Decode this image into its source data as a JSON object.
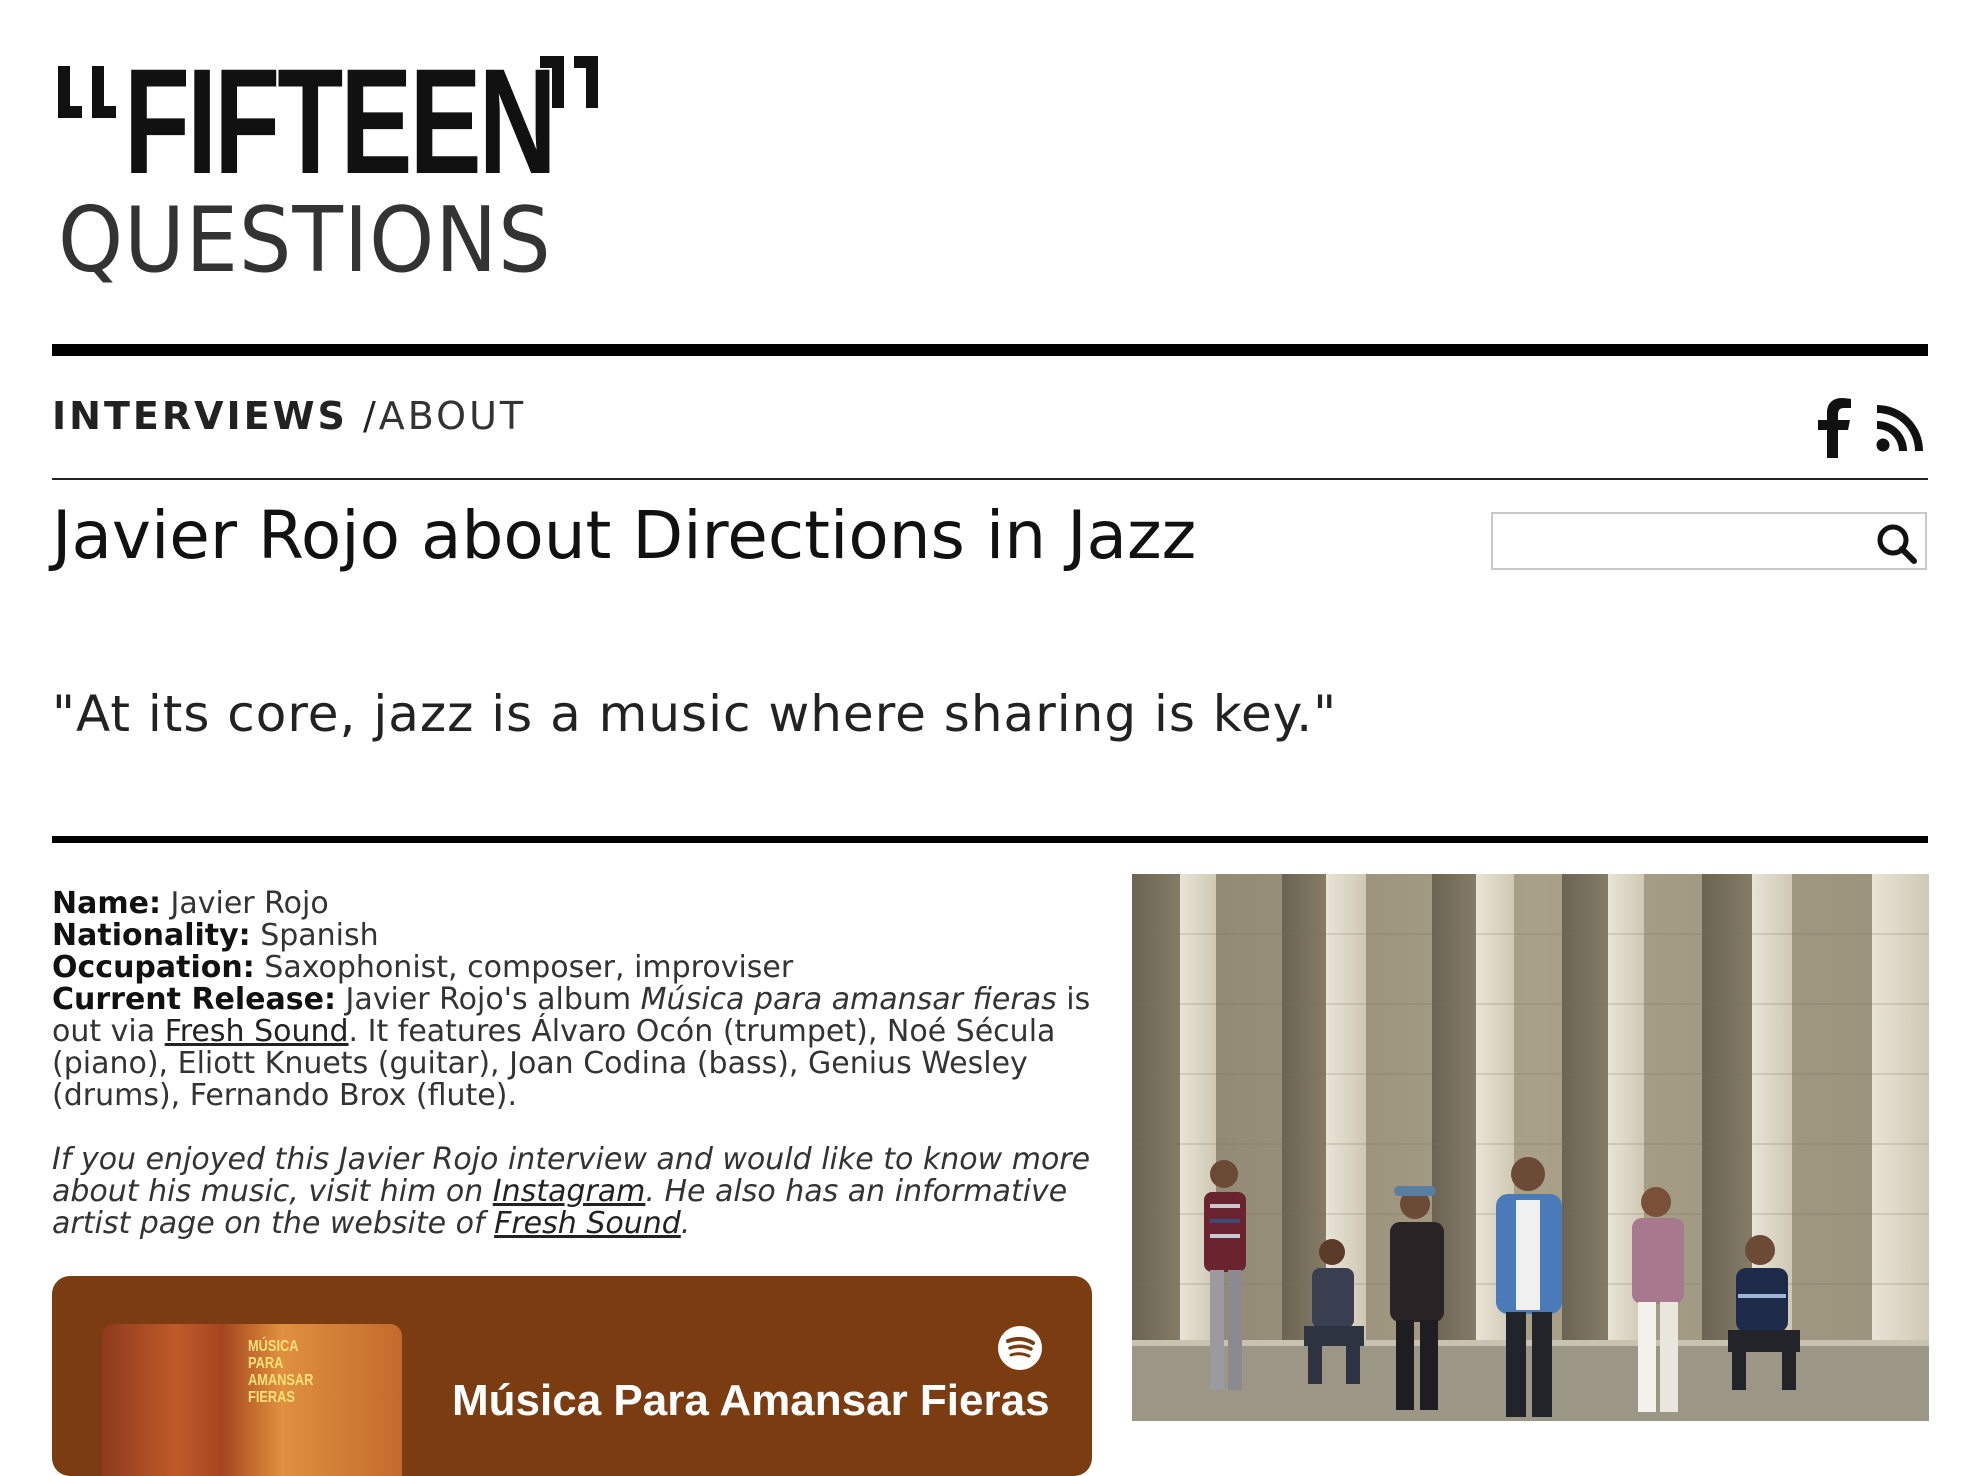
{
  "site": {
    "logo_top": "FIFTEEN",
    "logo_bottom": "QUESTIONS"
  },
  "nav": {
    "interviews": "INTERVIEWS",
    "separator": " /",
    "about": "ABOUT"
  },
  "social": {
    "icons": [
      "facebook-icon",
      "rss-icon"
    ]
  },
  "search": {
    "value": "",
    "placeholder": ""
  },
  "article": {
    "title": "Javier Rojo about Directions in Jazz",
    "quote": "\"At its core, jazz is a music where sharing is key.\""
  },
  "info": {
    "name_label": "Name:",
    "name": "Javier Rojo",
    "nationality_label": "Nationality:",
    "nationality": "Spanish",
    "occupation_label": "Occupation:",
    "occupation": "Saxophonist, composer, improviser",
    "release_label": "Current Release:",
    "release_pre": "Javier Rojo's album ",
    "release_album": "Música para amansar fieras",
    "release_mid": " is out via ",
    "release_label_link": "Fresh Sound",
    "release_post": ". It features Álvaro Ocón (trumpet), Noé Sécula (piano), Eliott Knuets (guitar), Joan Codina (bass), Genius Wesley (drums), Fernando Brox (flute).",
    "cta_pre": "If you enjoyed this Javier Rojo interview and would like to know more about his music, visit him on ",
    "cta_link1": "Instagram",
    "cta_mid": ". He also has an informative artist page on the website of ",
    "cta_link2": "Fresh Sound",
    "cta_post": "."
  },
  "embed": {
    "cover_text": "MÚSICA\nPARA\nAMANSAR\nFIERAS",
    "title": "Música Para Amansar Fieras",
    "icon": "spotify-icon",
    "background": "#7a3c10"
  },
  "photo": {
    "alt": "band-photo"
  }
}
